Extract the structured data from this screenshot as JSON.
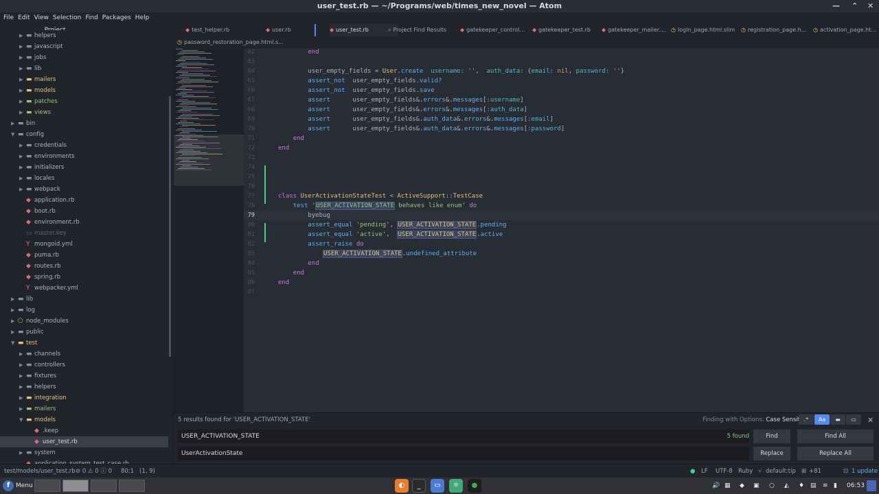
{
  "window": {
    "title": "user_test.rb — ~/Programs/web/times_new_novel — Atom"
  },
  "menu": [
    "File",
    "Edit",
    "View",
    "Selection",
    "Find",
    "Packages",
    "Help"
  ],
  "project_tab": "Project",
  "tabs": [
    {
      "label": "test_helper.rb",
      "icon": "ruby-icon"
    },
    {
      "label": "user.rb",
      "icon": "ruby-icon"
    },
    {
      "label": "user_test.rb",
      "icon": "ruby-icon",
      "active": true
    },
    {
      "label": "Project Find Results",
      "icon": "search-icon"
    },
    {
      "label": "gatekeeper_control...",
      "icon": "ruby-icon"
    },
    {
      "label": "gatekeeper_test.rb",
      "icon": "ruby-icon"
    },
    {
      "label": "gatekeeper_mailer....",
      "icon": "ruby-icon"
    },
    {
      "label": "login_page.html.slim",
      "icon": "slim-icon"
    },
    {
      "label": "registration_page.h...",
      "icon": "slim-icon"
    },
    {
      "label": "activation_page.ht...",
      "icon": "slim-icon"
    },
    {
      "label": "password_restoration_page.html.s...",
      "icon": "slim-icon"
    }
  ],
  "tree": [
    {
      "label": "helpers",
      "kind": "folder",
      "indent": 1
    },
    {
      "label": "javascript",
      "kind": "folder",
      "indent": 1
    },
    {
      "label": "jobs",
      "kind": "folder",
      "indent": 1
    },
    {
      "label": "lib",
      "kind": "folder",
      "indent": 1
    },
    {
      "label": "mailers",
      "kind": "folder-yellow",
      "indent": 1
    },
    {
      "label": "models",
      "kind": "folder-yellow",
      "indent": 1
    },
    {
      "label": "patches",
      "kind": "folder-green",
      "indent": 1
    },
    {
      "label": "views",
      "kind": "folder-green",
      "indent": 1
    },
    {
      "label": "bin",
      "kind": "folder",
      "indent": 0
    },
    {
      "label": "config",
      "kind": "folder-open",
      "indent": 0
    },
    {
      "label": "credentials",
      "kind": "folder",
      "indent": 1
    },
    {
      "label": "environments",
      "kind": "folder",
      "indent": 1
    },
    {
      "label": "initializers",
      "kind": "folder",
      "indent": 1
    },
    {
      "label": "locales",
      "kind": "folder",
      "indent": 1
    },
    {
      "label": "webpack",
      "kind": "folder",
      "indent": 1
    },
    {
      "label": "application.rb",
      "kind": "ruby",
      "indent": 1
    },
    {
      "label": "boot.rb",
      "kind": "ruby",
      "indent": 1
    },
    {
      "label": "environment.rb",
      "kind": "ruby",
      "indent": 1
    },
    {
      "label": "master.key",
      "kind": "key",
      "indent": 1
    },
    {
      "label": "mongoid.yml",
      "kind": "yml",
      "indent": 1
    },
    {
      "label": "puma.rb",
      "kind": "ruby",
      "indent": 1
    },
    {
      "label": "routes.rb",
      "kind": "ruby",
      "indent": 1
    },
    {
      "label": "spring.rb",
      "kind": "ruby",
      "indent": 1
    },
    {
      "label": "webpacker.yml",
      "kind": "yml",
      "indent": 1
    },
    {
      "label": "lib",
      "kind": "folder",
      "indent": 0
    },
    {
      "label": "log",
      "kind": "folder",
      "indent": 0
    },
    {
      "label": "node_modules",
      "kind": "node",
      "indent": 0
    },
    {
      "label": "public",
      "kind": "folder",
      "indent": 0
    },
    {
      "label": "test",
      "kind": "folder-open-yellow",
      "indent": 0
    },
    {
      "label": "channels",
      "kind": "folder",
      "indent": 1
    },
    {
      "label": "controllers",
      "kind": "folder",
      "indent": 1
    },
    {
      "label": "fixtures",
      "kind": "folder",
      "indent": 1
    },
    {
      "label": "helpers",
      "kind": "folder",
      "indent": 1
    },
    {
      "label": "integration",
      "kind": "folder-yellow",
      "indent": 1
    },
    {
      "label": "mailers",
      "kind": "folder-green",
      "indent": 1
    },
    {
      "label": "models",
      "kind": "folder-open-yellow",
      "indent": 1
    },
    {
      "label": ".keep",
      "kind": "ruby",
      "indent": 2
    },
    {
      "label": "user_test.rb",
      "kind": "ruby-selected",
      "indent": 2
    },
    {
      "label": "system",
      "kind": "folder",
      "indent": 1
    },
    {
      "label": "application_system_test_case.rb",
      "kind": "ruby",
      "indent": 1
    }
  ],
  "code_lines": [
    {
      "n": "62",
      "html": "        <span class=\"kw\">end</span>"
    },
    {
      "n": "63",
      "html": ""
    },
    {
      "n": "64",
      "html": "        user_empty_fields = <span class=\"const\">User</span>.<span class=\"fn\">create</span>  <span class=\"sym\">username:</span> <span class=\"str\">''</span>,  <span class=\"sym\">auth_data:</span> {<span class=\"sym\">email:</span> <span class=\"nil\">nil</span>, <span class=\"sym\">password:</span> <span class=\"str\">''</span>}"
    },
    {
      "n": "65",
      "html": "        <span class=\"fn\">assert_not</span>  user_empty_fields.<span class=\"fn\">valid?</span>"
    },
    {
      "n": "66",
      "html": "        <span class=\"fn\">assert_not</span>  user_empty_fields.<span class=\"fn\">save</span>"
    },
    {
      "n": "67",
      "html": "        <span class=\"fn\">assert</span>      user_empty_fields&amp;.<span class=\"fn\">errors</span>&amp;.<span class=\"fn\">messages</span>[<span class=\"sym\">:username</span>]"
    },
    {
      "n": "68",
      "html": "        <span class=\"fn\">assert</span>      user_empty_fields&amp;.<span class=\"fn\">errors</span>&amp;.<span class=\"fn\">messages</span>[<span class=\"sym\">:auth_data</span>]"
    },
    {
      "n": "69",
      "html": "        <span class=\"fn\">assert</span>      user_empty_fields&amp;.<span class=\"fn\">auth_data</span>&amp;.<span class=\"fn\">errors</span>&amp;.<span class=\"fn\">messages</span>[<span class=\"sym\">:email</span>]"
    },
    {
      "n": "70",
      "html": "        <span class=\"fn\">assert</span>      user_empty_fields&amp;.<span class=\"fn\">auth_data</span>&amp;.<span class=\"fn\">errors</span>&amp;.<span class=\"fn\">messages</span>[<span class=\"sym\">:password</span>]"
    },
    {
      "n": "71",
      "html": "    <span class=\"kw\">end</span>"
    },
    {
      "n": "72",
      "html": "<span class=\"kw\">end</span>"
    },
    {
      "n": "73",
      "html": ""
    },
    {
      "n": "74",
      "html": ""
    },
    {
      "n": "75",
      "html": ""
    },
    {
      "n": "76",
      "html": ""
    },
    {
      "n": "77",
      "html": "<span class=\"kw\">class</span> <span class=\"const\">UserActivationStateTest</span> &lt; <span class=\"const\">ActiveSupport</span>::<span class=\"const\">TestCase</span>"
    },
    {
      "n": "78",
      "html": "    <span class=\"fn\">test</span> <span class=\"str\">'<span class=\"hl\">USER_ACTIVATION_STATE</span> behaves like enum'</span> <span class=\"kw\">do</span>"
    },
    {
      "n": "79",
      "html": "        byebug",
      "current": true
    },
    {
      "n": "80",
      "html": "        <span class=\"fn\">assert_equal</span> <span class=\"str\">'pending'</span>, <span class=\"hl\"><span class=\"const\">USER_ACTIVATION_STATE</span></span>.<span class=\"fn\">pending</span>"
    },
    {
      "n": "81",
      "html": "        <span class=\"fn\">assert_equal</span> <span class=\"str\">'active'</span>,  <span class=\"hl\"><span class=\"const\">USER_ACTIVATION_STATE</span></span>.<span class=\"fn\">active</span>"
    },
    {
      "n": "82",
      "html": "        <span class=\"fn\">assert_raise</span> <span class=\"kw\">do</span>"
    },
    {
      "n": "83",
      "html": "            <span class=\"hl\"><span class=\"const\">USER_ACTIVATION_STATE</span></span>.<span class=\"fn\">undefined_attribute</span>"
    },
    {
      "n": "84",
      "html": "        <span class=\"kw\">end</span>"
    },
    {
      "n": "85",
      "html": "    <span class=\"kw\">end</span>"
    },
    {
      "n": "86",
      "html": "<span class=\"kw\">end</span>"
    },
    {
      "n": "87",
      "html": ""
    }
  ],
  "find": {
    "info": "5 results found for 'USER_ACTIVATION_STATE'",
    "options_label": "Finding with Options:",
    "options_value": "Case Sensitive",
    "find_value": "USER_ACTIVATION_STATE",
    "replace_value": "UserActivationState",
    "count": "5 found",
    "find_btn": "Find",
    "find_all_btn": "Find All",
    "replace_btn": "Replace",
    "replace_all_btn": "Replace All",
    "regex_label": ".*",
    "case_label": "Aa"
  },
  "status": {
    "path": "test/models/user_test.rb",
    "diagnostics": "⊘ 0 ⚠ 0 ⓘ 0",
    "cursor": "80:1",
    "selection": "(1, 9)",
    "line_ending": "LF",
    "encoding": "UTF-8",
    "grammar": "Ruby",
    "branch": "default:tip",
    "git": "+81",
    "updates": "1 update"
  },
  "taskbar": {
    "menu_label": "Menu",
    "time": "06:53"
  }
}
